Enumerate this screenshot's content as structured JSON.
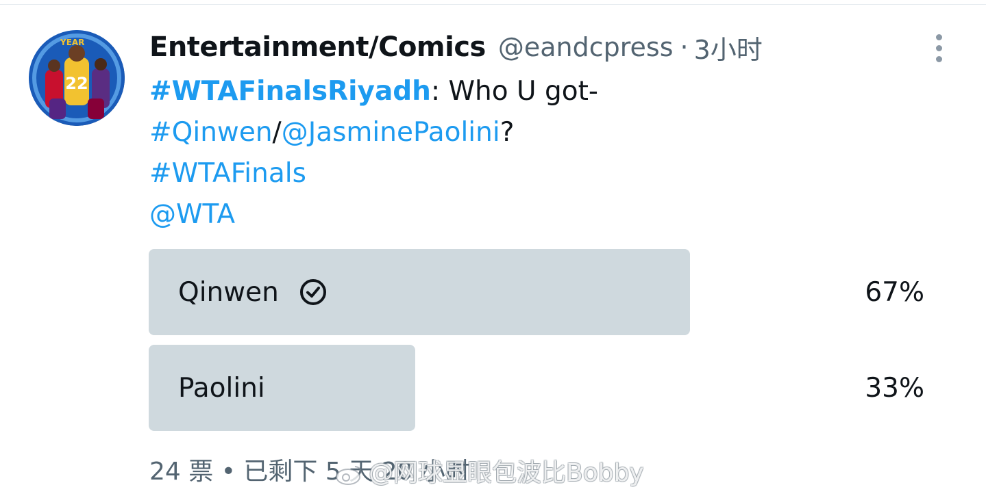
{
  "author": {
    "display_name": "Entertainment/Comics",
    "handle": "@eandcpress",
    "separator": "·",
    "time": "3小时"
  },
  "tweet": {
    "lines": [
      [
        {
          "text": "#WTAFinalsRiyadh",
          "type": "hashtag-bold"
        },
        {
          "text": ": Who U got-",
          "type": "plain"
        }
      ],
      [
        {
          "text": "#Qinwen",
          "type": "hashtag"
        },
        {
          "text": "/",
          "type": "plain"
        },
        {
          "text": "@JasminePaolini",
          "type": "mention"
        },
        {
          "text": "?",
          "type": "plain"
        }
      ],
      [
        {
          "text": "#WTAFinals",
          "type": "hashtag"
        }
      ],
      [
        {
          "text": "@WTA",
          "type": "mention"
        }
      ]
    ]
  },
  "poll": {
    "options": [
      {
        "label": "Qinwen",
        "percent_text": "67%",
        "percent": 67,
        "winner": true
      },
      {
        "label": "Paolini",
        "percent_text": "33%",
        "percent": 33,
        "winner": false
      }
    ],
    "meta": "24 票 • 已剩下 5 天 20 小时"
  },
  "watermark": {
    "text": "@网球显眼包波比Bobby"
  },
  "colors": {
    "link": "#1d9bf0",
    "bar": "#cfd9de",
    "muted": "#536471"
  },
  "icons": {
    "more": "more-vertical-icon",
    "check": "check-circle-icon"
  }
}
